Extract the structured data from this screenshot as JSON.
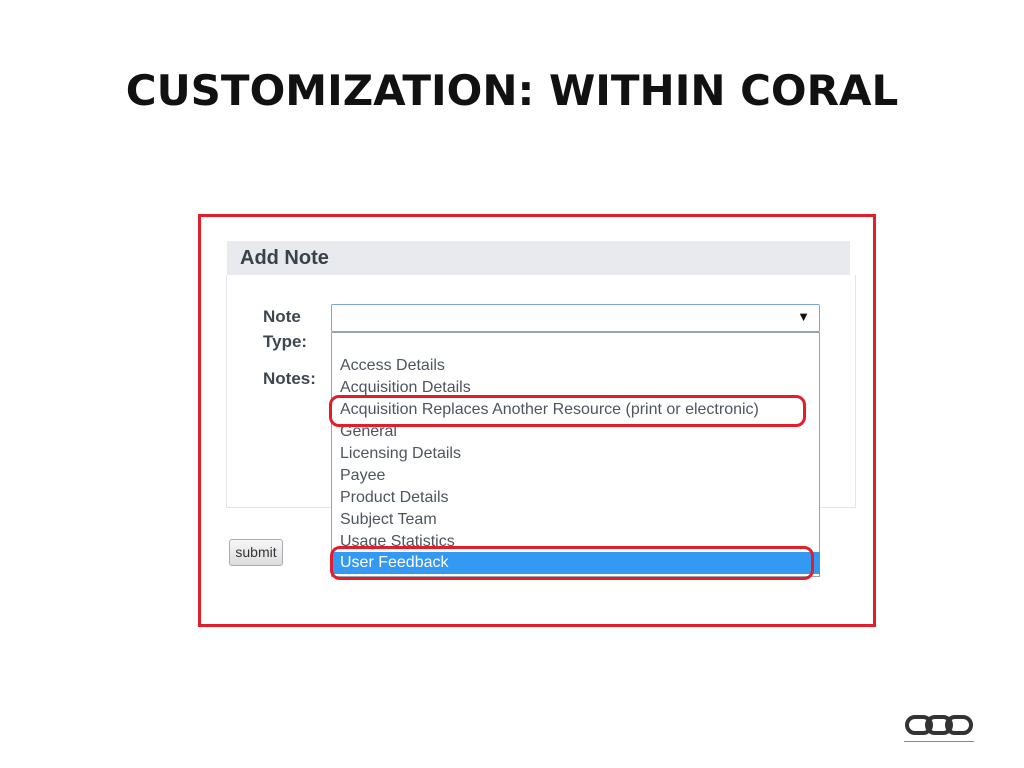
{
  "slide": {
    "title": "CUSTOMIZATION: WITHIN CORAL"
  },
  "form": {
    "title": "Add Note",
    "note_type_label_line1": "Note",
    "note_type_label_line2": "Type:",
    "notes_label": "Notes:",
    "select_value": "",
    "options": [
      "Access Details",
      "Acquisition Details",
      "Acquisition Replaces Another Resource (print or electronic)",
      "General",
      "Licensing Details",
      "Payee",
      "Product Details",
      "Subject Team",
      "Usage Statistics",
      "User Feedback"
    ],
    "selected_option": "User Feedback",
    "submit_label": "submit"
  },
  "colors": {
    "highlight": "#e21e2b",
    "selected_bg": "#3399f3",
    "header_bg": "#e8eaed"
  },
  "icons": {
    "logo": "chain-link-icon",
    "dropdown_arrow": "triangle-down-icon"
  }
}
